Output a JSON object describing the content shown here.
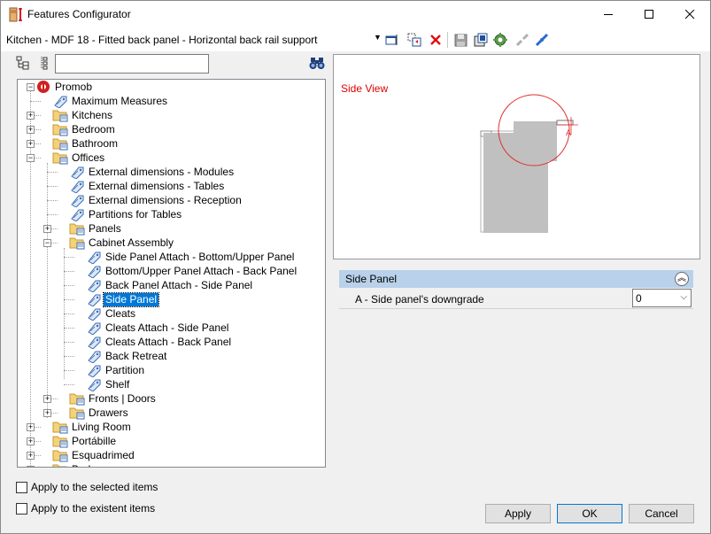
{
  "window": {
    "title": "Features Configurator"
  },
  "header": {
    "feature_path": "Kitchen - MDF 18 - Fitted back panel - Horizontal back rail support"
  },
  "toolbar": {
    "icons": [
      "properties-icon",
      "copy-icon",
      "delete-icon",
      "save-icon",
      "export-icon",
      "settings-icon",
      "disconnect-icon",
      "connect-icon"
    ]
  },
  "search": {
    "value": "",
    "placeholder": ""
  },
  "tree": {
    "root": "Promob",
    "items": [
      "Maximum Measures",
      "Kitchens",
      "Bedroom",
      "Bathroom",
      "Offices",
      "External dimensions - Modules",
      "External dimensions - Tables",
      "External dimensions - Reception",
      "Partitions for Tables",
      "Panels",
      "Cabinet Assembly",
      "Side Panel Attach - Bottom/Upper Panel",
      " Bottom/Upper Panel Attach - Back Panel",
      "Back Panel Attach - Side Panel",
      "Side Panel",
      "Cleats",
      "Cleats Attach - Side Panel",
      "Cleats Attach - Back Panel",
      "Back Retreat",
      "Partition",
      "Shelf",
      "Fronts | Doors",
      "Drawers",
      "Living Room",
      "Portábille",
      "Esquadrimed",
      "Bedroom"
    ],
    "selected": "Side Panel"
  },
  "options": {
    "apply_selected": "Apply to the selected items",
    "apply_existent": "Apply to the existent items"
  },
  "preview": {
    "label": "Side View",
    "marker": "A"
  },
  "properties": {
    "category": "Side Panel",
    "rows": [
      {
        "name": "A - Side panel's downgrade",
        "value": "0"
      }
    ]
  },
  "buttons": {
    "apply": "Apply",
    "ok": "OK",
    "cancel": "Cancel"
  },
  "colors": {
    "selection": "#0078d7",
    "category_header": "#b9d1ea",
    "preview_label": "#e00000",
    "panel_fill": "#c0c0c0"
  }
}
